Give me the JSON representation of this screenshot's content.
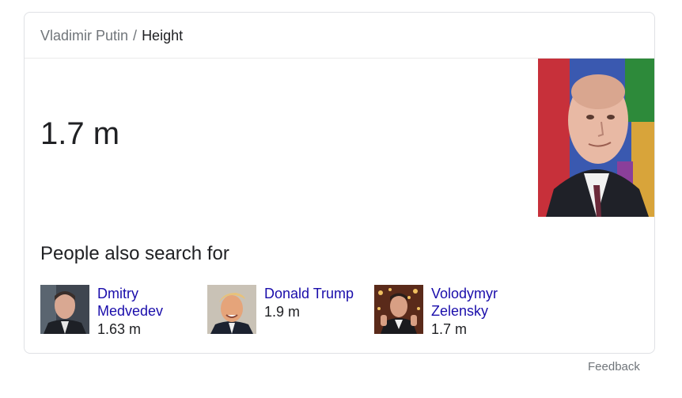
{
  "breadcrumb": {
    "parent": "Vladimir Putin",
    "separator": "/",
    "current": "Height"
  },
  "answer": {
    "value": "1.7 m"
  },
  "hero_image": {
    "subject": "portrait-photo-vladimir-putin"
  },
  "people_also_search": {
    "title": "People also search for",
    "items": [
      {
        "name_line1": "Dmitry",
        "name_line2": "Medvedev",
        "value": "1.63 m"
      },
      {
        "name_line1": "Donald Trump",
        "name_line2": "",
        "value": "1.9 m"
      },
      {
        "name_line1": "Volodymyr",
        "name_line2": "Zelensky",
        "value": "1.7 m"
      }
    ]
  },
  "footer": {
    "feedback_label": "Feedback"
  },
  "colors": {
    "link": "#1a0dab",
    "muted": "#70757a",
    "text": "#202124",
    "border": "#dfe1e5"
  }
}
